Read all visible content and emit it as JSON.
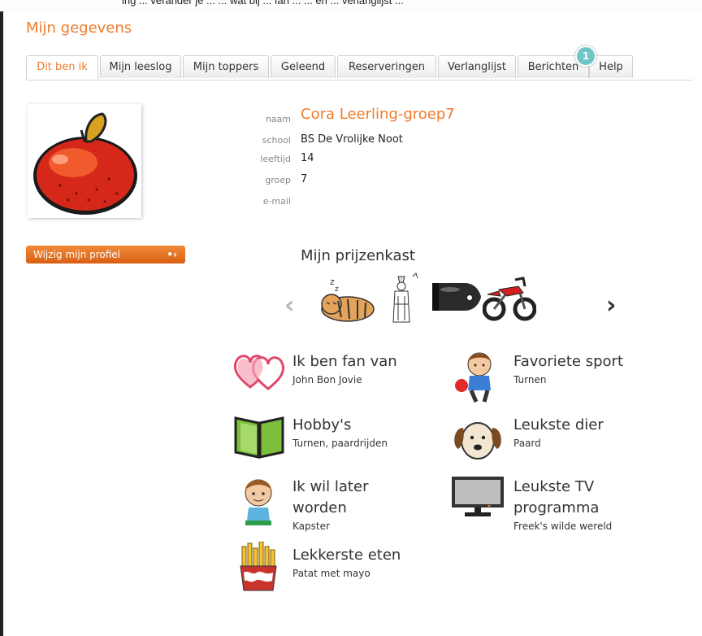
{
  "caption": "ing ... verander je ... ... wat bij ... fan ... ... en ... verlanglijst ...",
  "page": {
    "title": "Mijn gegevens"
  },
  "tabs": [
    {
      "label": "Dit ben ik",
      "active": true
    },
    {
      "label": "Mijn leeslog"
    },
    {
      "label": "Mijn toppers"
    },
    {
      "label": "Geleend"
    },
    {
      "label": "Reserveringen"
    },
    {
      "label": "Verlanglijst"
    },
    {
      "label": "Berichten",
      "badge": "1"
    },
    {
      "label": "Help"
    }
  ],
  "profile": {
    "name_label": "naam",
    "name": "Cora Leerling-groep7",
    "school_label": "school",
    "school": "BS De Vrolijke Noot",
    "age_label": "leeftijd",
    "age": "14",
    "group_label": "groep",
    "group": "7",
    "email_label": "e-mail",
    "email": ""
  },
  "edit_button": "Wijzig mijn profiel",
  "prizes": {
    "title": "Mijn prijzenkast",
    "items": [
      "sleeping-tiger-icon",
      "pharaoh-icon",
      "bullet-icon",
      "motorbike-icon"
    ]
  },
  "favorites": [
    {
      "title": "Ik ben fan van",
      "value": "John Bon Jovie",
      "icon": "hearts-icon"
    },
    {
      "title": "Favoriete sport",
      "value": "Turnen",
      "icon": "boy-ball-icon"
    },
    {
      "title": "Hobby's",
      "value": "Turnen, paardrijden",
      "icon": "book-icon"
    },
    {
      "title": "Leukste dier",
      "value": "Paard",
      "icon": "dog-icon"
    },
    {
      "title": "Ik wil later worden",
      "value": "Kapster",
      "icon": "boy-icon"
    },
    {
      "title": "Leukste TV programma",
      "value": "Freek's wilde wereld",
      "icon": "tv-icon"
    },
    {
      "title": "Lekkerste eten",
      "value": "Patat met mayo",
      "icon": "fries-icon"
    }
  ],
  "colors": {
    "accent": "#f07b2a",
    "badge": "#6ec7c4",
    "button": "#e06a1c"
  }
}
